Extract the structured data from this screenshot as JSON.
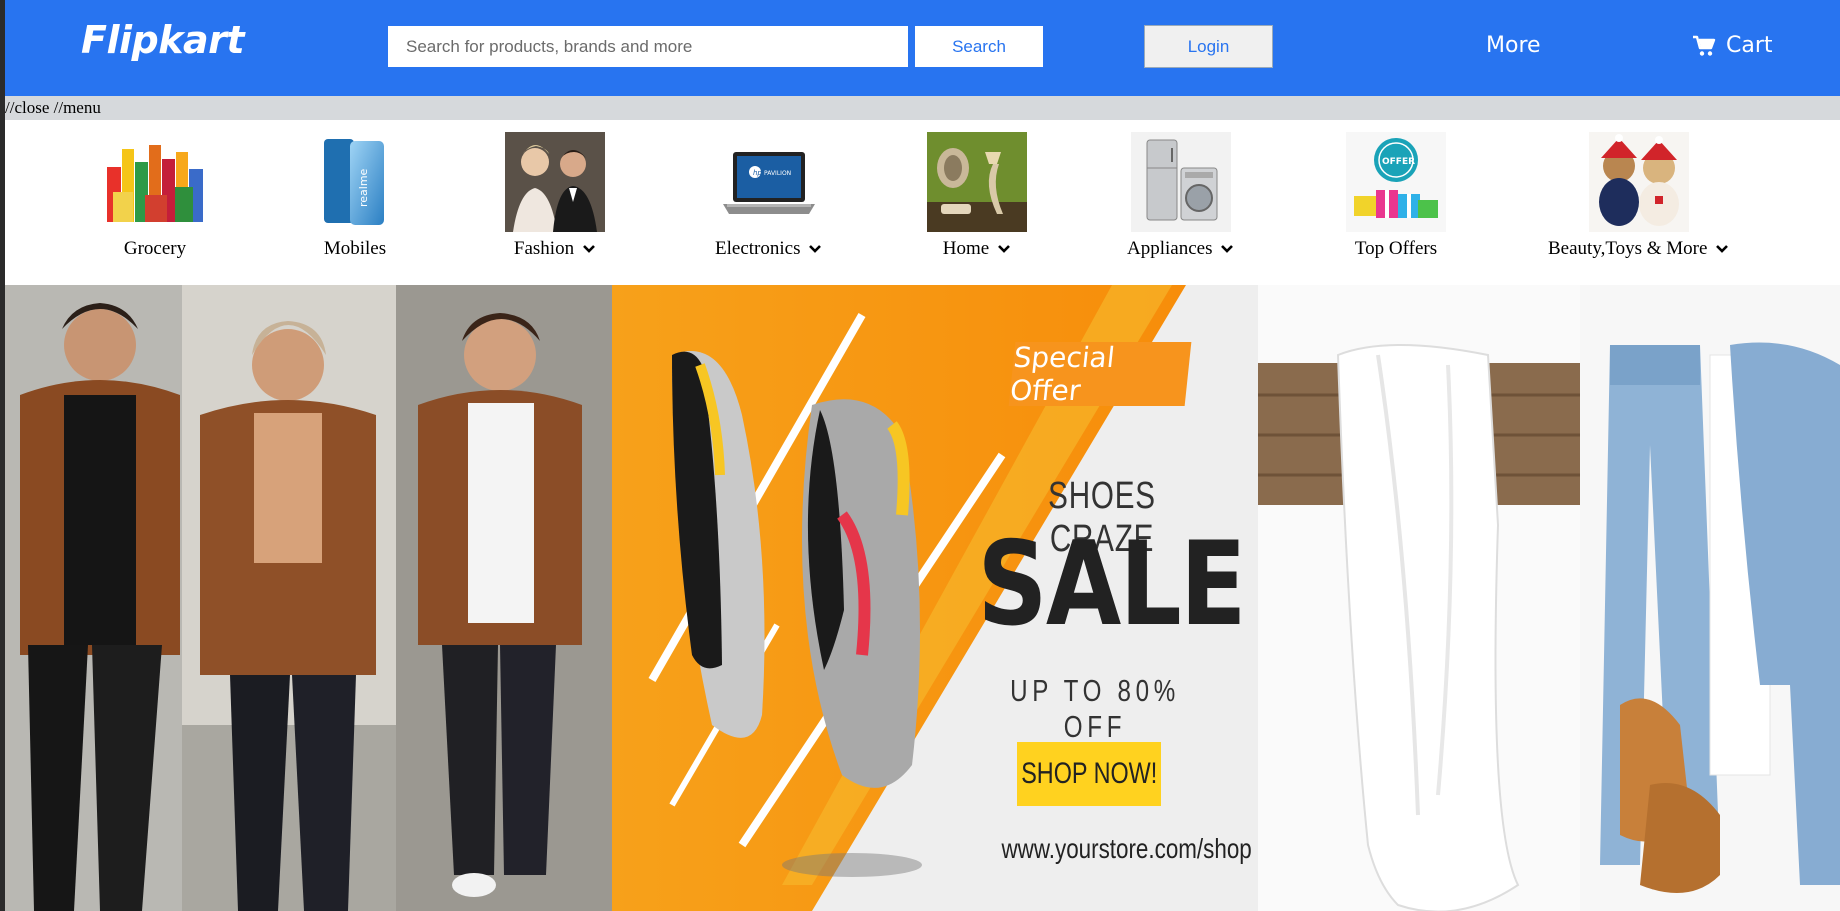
{
  "header": {
    "logo": "Flipkart",
    "search_placeholder": "Search for products, brands and more",
    "search_label": "Search",
    "login_label": "Login",
    "more_label": "More",
    "cart_label": "Cart",
    "colors": {
      "brand": "#2874f0"
    }
  },
  "toggle": {
    "text": "//close //menu"
  },
  "categories": [
    {
      "label": "Grocery",
      "icon": "grocery-icon",
      "dropdown": false
    },
    {
      "label": "Mobiles",
      "icon": "mobile-phone-icon",
      "dropdown": false
    },
    {
      "label": "Fashion",
      "icon": "fashion-icon",
      "dropdown": true
    },
    {
      "label": "Electronics",
      "icon": "laptop-icon",
      "dropdown": true
    },
    {
      "label": "Home",
      "icon": "home-decor-icon",
      "dropdown": true
    },
    {
      "label": "Appliances",
      "icon": "appliances-icon",
      "dropdown": true
    },
    {
      "label": "Top Offers",
      "icon": "offers-icon",
      "dropdown": false
    },
    {
      "label": "Beauty,Toys & More",
      "icon": "teddy-bears-icon",
      "dropdown": true
    }
  ],
  "banner": {
    "special_offer": "Special Offer",
    "headline": "SHOES CRAZE",
    "sale": "SALE",
    "discount": "UP TO 80% OFF",
    "cta": "SHOP NOW!",
    "url": "www.yourstore.com/shop",
    "colors": {
      "orange": "#f7941d",
      "yellow": "#ffd21f"
    }
  }
}
